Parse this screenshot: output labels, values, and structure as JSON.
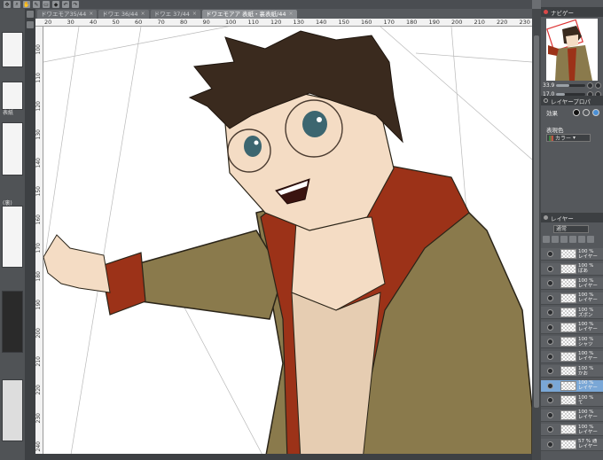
{
  "tabs": [
    {
      "label": "ドワエモア35/44",
      "active": false
    },
    {
      "label": "ドワエ 36/44",
      "active": false
    },
    {
      "label": "ドワエ 37/44",
      "active": false
    },
    {
      "label": "ドワエモアア 表紙・裏表紙/44",
      "active": true
    }
  ],
  "ruler_top": [
    "20",
    "30",
    "40",
    "50",
    "60",
    "70",
    "80",
    "90",
    "100",
    "110",
    "120",
    "130",
    "140",
    "150",
    "160",
    "170",
    "180",
    "190",
    "200",
    "210",
    "220",
    "230"
  ],
  "ruler_left": [
    "100",
    "110",
    "120",
    "130",
    "140",
    "150",
    "160",
    "170",
    "180",
    "190",
    "200",
    "210",
    "220",
    "230",
    "240"
  ],
  "left_panel": {
    "thumb_labels": [
      "表紙",
      "(裏)"
    ]
  },
  "navigator": {
    "title": "ナビゲー",
    "zoom_label": "33.9",
    "zoom_fraction": 0.45,
    "rotate_label": "17.0",
    "rotate_fraction": 0.3
  },
  "layer_property": {
    "title": "レイヤープロパ",
    "effect_label": "効果",
    "expression_color_label": "表現色",
    "expression_color_value": "カラー"
  },
  "layers_panel": {
    "title": "レイヤー",
    "blend_mode": "通常",
    "rows": [
      {
        "line1": "100 %",
        "line2": "レイヤー",
        "selected": false
      },
      {
        "line1": "100 %",
        "line2": "ばあ",
        "selected": false
      },
      {
        "line1": "100 %",
        "line2": "レイヤー",
        "selected": false
      },
      {
        "line1": "100 %",
        "line2": "レイヤー",
        "selected": false
      },
      {
        "line1": "100 %",
        "line2": "ズボン",
        "selected": false
      },
      {
        "line1": "100 %",
        "line2": "レイヤー",
        "selected": false
      },
      {
        "line1": "100 %",
        "line2": "シャツ",
        "selected": false
      },
      {
        "line1": "100 %",
        "line2": "レイヤー",
        "selected": false
      },
      {
        "line1": "100 %",
        "line2": "かお",
        "selected": false
      },
      {
        "line1": "100 %",
        "line2": "レイヤー",
        "selected": true
      },
      {
        "line1": "100 %",
        "line2": "て",
        "selected": false
      },
      {
        "line1": "100 %",
        "line2": "レイヤー",
        "selected": false
      },
      {
        "line1": "100 %",
        "line2": "レイヤー",
        "selected": false
      },
      {
        "line1": "57 % 通",
        "line2": "レイヤー",
        "selected": false
      }
    ]
  },
  "colors": {
    "hair": "#3a2a1e",
    "jacket": "#8a7a4c",
    "hood_inner": "#9c3218",
    "skin": "#f4dcc4",
    "shirt": "#e6cdb2",
    "eyes": "#3c6670",
    "selected_layer": "#7aa7d6"
  }
}
